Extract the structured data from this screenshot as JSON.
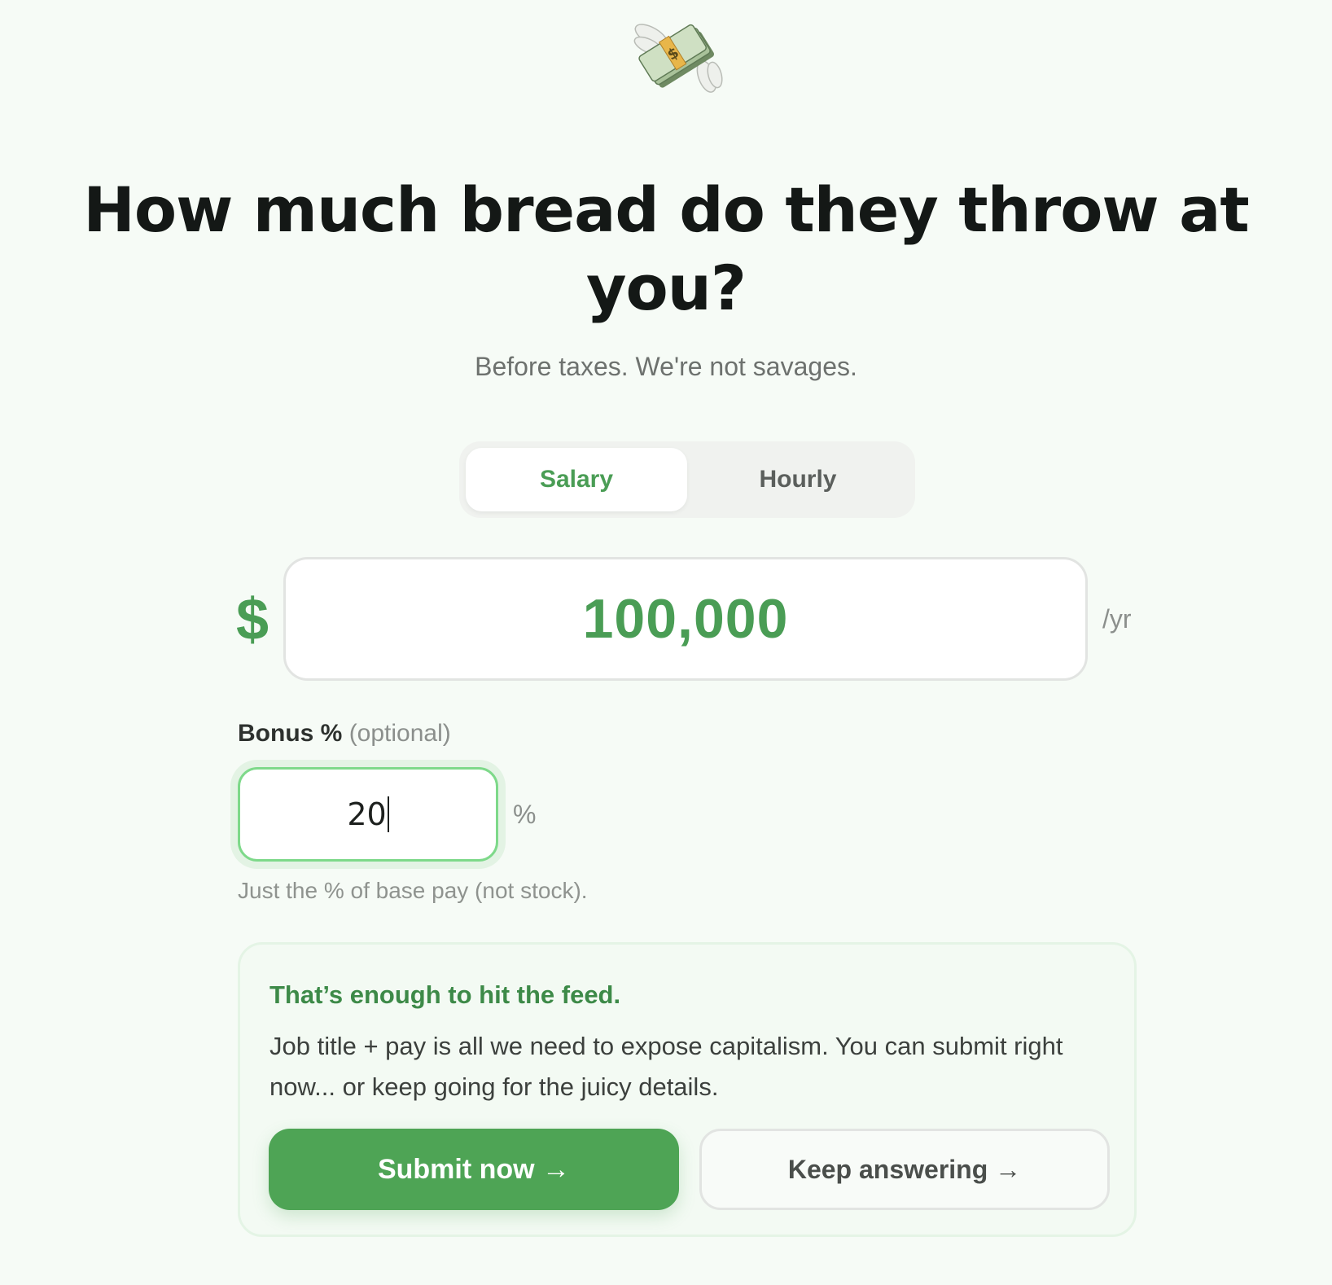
{
  "header": {
    "logo_icon": "money-with-wings-icon",
    "title": "How much bread do they throw at you?",
    "subtitle": "Before taxes. We're not savages."
  },
  "pay_type": {
    "options": [
      {
        "label": "Salary",
        "selected": true
      },
      {
        "label": "Hourly",
        "selected": false
      }
    ]
  },
  "amount": {
    "currency_symbol": "$",
    "value": "100,000",
    "unit": "/yr"
  },
  "bonus": {
    "label": "Bonus %",
    "optional_label": "(optional)",
    "value": "20",
    "suffix": "%",
    "hint": "Just the % of base pay (not stock)."
  },
  "callout": {
    "title": "That’s enough to hit the feed.",
    "body": "Job title + pay is all we need to expose capitalism. You can submit right now... or keep going for the juicy details.",
    "submit_label": "Submit now →",
    "keep_label": "Keep answering →"
  },
  "colors": {
    "accent": "#4ea455",
    "background": "#f6fbf6",
    "focus_ring": "#7ed98a"
  }
}
